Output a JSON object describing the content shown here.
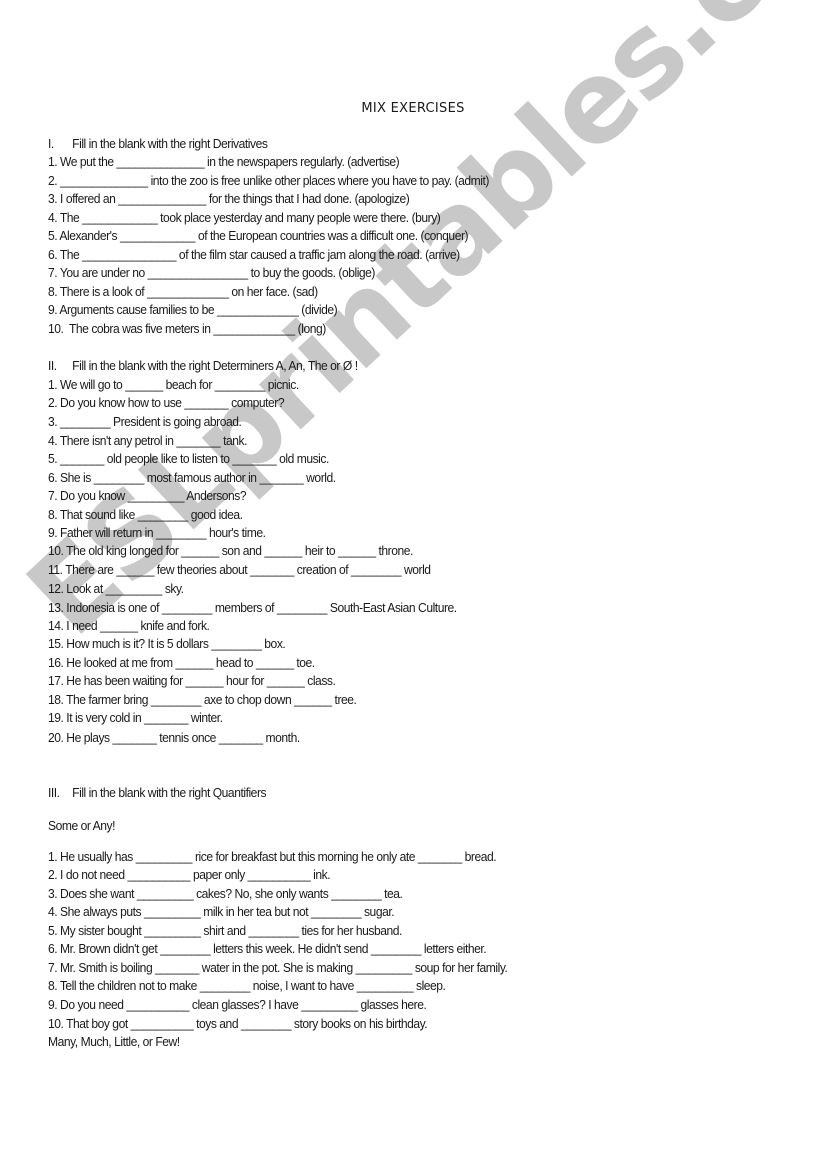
{
  "watermark": "ESLprintables.com",
  "title": "MIX EXERCISES",
  "sections": [
    {
      "number": "I.",
      "heading": "Fill in the blank with the right Derivatives",
      "items": [
        "1. We put the ______________ in the newspapers regularly. (advertise)",
        "2. ______________ into the zoo is free unlike other places where you have to pay. (admit)",
        "3. I offered an ______________ for the things that I had done. (apologize)",
        "4. The ____________ took place yesterday and many people were there. (bury)",
        "5. Alexander's ____________ of the European countries was a difficult one. (conquer)",
        "6. The _______________ of the film star caused a traffic jam along the road. (arrive)",
        "7. You are under no ________________ to buy the goods. (oblige)",
        "8. There is a look of _____________ on her face. (sad)",
        "9. Arguments cause families to be _____________ (divide)",
        "10.  The cobra was five meters in _____________ (long)"
      ]
    },
    {
      "number": "II.",
      "heading": "Fill in the blank with the right Determiners A, An, The or Ø !",
      "items": [
        "1. We will go to ______ beach for ________ picnic.",
        "2. Do you know how to use _______ computer?",
        "3. ________ President is going abroad.",
        "4. There isn't any petrol in _______ tank.",
        "5. _______ old people like to listen to _______ old music.",
        "6. She is ________ most famous author in _______ world.",
        "7. Do you know _________ Andersons?",
        "8. That sound like ________ good idea.",
        "9. Father will return in ________ hour's time.",
        "10. The old king longed for ______ son and ______ heir to ______ throne.",
        "11. There are ______ few theories about _______ creation of ________ world",
        "12. Look at _________ sky.",
        "13. Indonesia is one of ________ members of ________ South-East Asian Culture.",
        "14. I need ______ knife and fork.",
        "15. How much is it? It is 5 dollars ________ box.",
        "16. He looked at me from ______ head to ______ toe.",
        "17. He has been waiting for ______ hour for ______ class.",
        "18. The farmer bring ________ axe to chop down ______ tree.",
        "19. It is very cold in _______ winter.",
        "20. He plays _______ tennis once _______ month."
      ]
    },
    {
      "number": "III.",
      "heading": "Fill in the blank with the right Quantifiers",
      "subheading": "Some or Any!",
      "items": [
        "1. He usually has _________ rice for breakfast but this morning he only ate _______ bread.",
        "2. I do not need __________ paper only __________ ink.",
        "3. Does she want _________ cakes? No, she only wants ________ tea.",
        "4. She always puts _________ milk in her tea but not ________ sugar.",
        "5. My sister bought _________ shirt and ________ ties for her husband.",
        "6. Mr. Brown didn't get ________ letters this week. He didn't send ________ letters either.",
        "7. Mr. Smith is boiling _______ water in the pot. She is making _________ soup for her family.",
        "8. Tell the children not to make ________ noise, I want to have _________ sleep.",
        "9. Do you need __________ clean glasses? I have _________ glasses here.",
        "10. That boy got __________ toys and ________ story books on his birthday."
      ],
      "footer": "Many, Much, Little, or Few!"
    }
  ]
}
